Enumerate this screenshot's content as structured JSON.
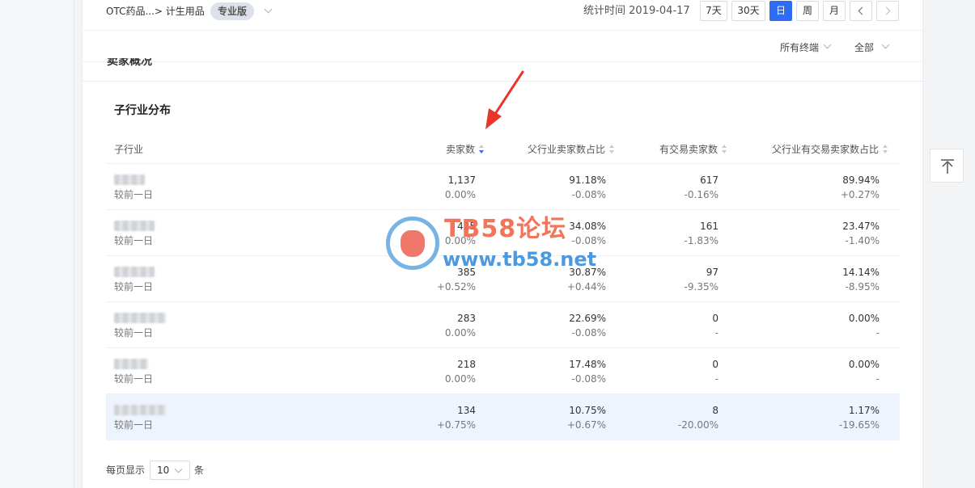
{
  "breadcrumb": "OTC药品...> 计生用品",
  "edition_badge": "专业版",
  "stat_time": "统计时间 2019-04-17",
  "date_ranges": [
    {
      "label": "7天",
      "active": false
    },
    {
      "label": "30天",
      "active": false
    },
    {
      "label": "日",
      "active": true
    },
    {
      "label": "周",
      "active": false
    },
    {
      "label": "月",
      "active": false
    }
  ],
  "filters": {
    "terminal": "所有终端",
    "scope": "全部"
  },
  "section_title_peek": "卖家概况",
  "sub_section": {
    "title": "子行业分布",
    "columns": [
      "子行业",
      "卖家数",
      "父行业卖家数占比",
      "有交易卖家数",
      "父行业有交易卖家数占比"
    ],
    "row_sub_label": "较前一日",
    "rows": [
      {
        "sellers": "1,137",
        "sellers_chg": "0.00%",
        "parent_ratio": "91.18%",
        "parent_ratio_chg": "-0.08%",
        "trading": "617",
        "trading_chg": "-0.16%",
        "trading_ratio": "89.94%",
        "trading_ratio_chg": "+0.27%"
      },
      {
        "sellers": "425",
        "sellers_chg": "0.00%",
        "parent_ratio": "34.08%",
        "parent_ratio_chg": "-0.08%",
        "trading": "161",
        "trading_chg": "-1.83%",
        "trading_ratio": "23.47%",
        "trading_ratio_chg": "-1.40%"
      },
      {
        "sellers": "385",
        "sellers_chg": "+0.52%",
        "parent_ratio": "30.87%",
        "parent_ratio_chg": "+0.44%",
        "trading": "97",
        "trading_chg": "-9.35%",
        "trading_ratio": "14.14%",
        "trading_ratio_chg": "-8.95%"
      },
      {
        "sellers": "283",
        "sellers_chg": "0.00%",
        "parent_ratio": "22.69%",
        "parent_ratio_chg": "-0.08%",
        "trading": "0",
        "trading_chg": "-",
        "trading_ratio": "0.00%",
        "trading_ratio_chg": "-"
      },
      {
        "sellers": "218",
        "sellers_chg": "0.00%",
        "parent_ratio": "17.48%",
        "parent_ratio_chg": "-0.08%",
        "trading": "0",
        "trading_chg": "-",
        "trading_ratio": "0.00%",
        "trading_ratio_chg": "-"
      },
      {
        "sellers": "134",
        "sellers_chg": "+0.75%",
        "parent_ratio": "10.75%",
        "parent_ratio_chg": "+0.67%",
        "trading": "8",
        "trading_chg": "-20.00%",
        "trading_ratio": "1.17%",
        "trading_ratio_chg": "-19.65%"
      }
    ]
  },
  "pagination": {
    "per_page_label": "每页显示",
    "per_page_value": "10",
    "unit": "条"
  },
  "watermark": {
    "title": "TB58论坛",
    "url": "www.tb58.net"
  },
  "icons": {
    "sort": "sort-icon",
    "chevron": "chevron-down-icon",
    "back_to_top": "back-to-top-icon"
  },
  "colors": {
    "accent": "#2f6cf6",
    "highlight_row": "#eef4fd",
    "annotation_arrow": "#e8352a"
  }
}
